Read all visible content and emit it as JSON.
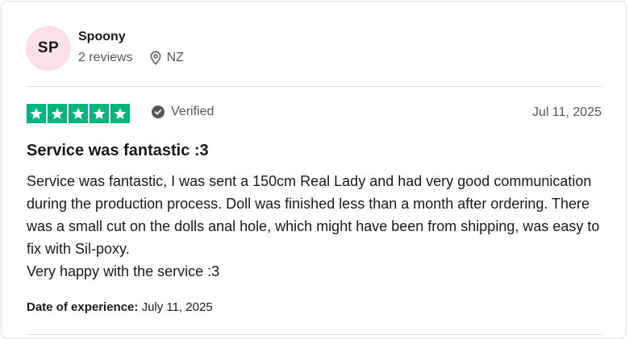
{
  "reviewer": {
    "initials": "SP",
    "name": "Spoony",
    "reviews": "2 reviews",
    "location": "NZ",
    "avatar_bg": "#fbe0ea"
  },
  "rating": {
    "stars": 5,
    "max": 5,
    "color": "#00b67a",
    "verified_label": "Verified"
  },
  "review": {
    "date": "Jul 11, 2025",
    "title": "Service was fantastic :3",
    "body": "Service was fantastic, I was sent a 150cm Real Lady and had very good communication during the production process. Doll was finished less than a month after ordering. There was a small cut on the dolls anal hole, which might have been from shipping, was easy to fix with Sil-poxy.",
    "body_line2": "Very happy with the service :3",
    "experience_label": "Date of experience:",
    "experience_value": "July 11, 2025"
  },
  "icons": {
    "location": "location-pin-icon",
    "verified": "check-circle-icon",
    "star": "star-icon"
  }
}
